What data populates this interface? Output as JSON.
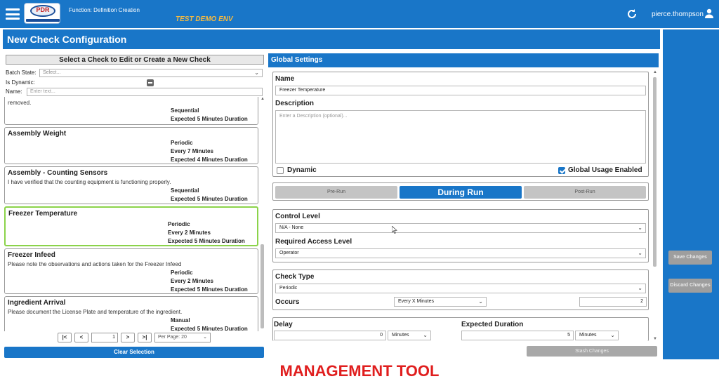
{
  "app": {
    "function_label": "Function: Definition Creation",
    "env_label": "TEST DEMO ENV",
    "logo_text": "PDR",
    "user": "pierce.thompson"
  },
  "page": {
    "title": "New Check Configuration"
  },
  "left": {
    "header": "Select a Check to Edit or Create a New Check",
    "batch_state_label": "Batch State:",
    "batch_state_placeholder": "Select...",
    "is_dynamic_label": "Is Dynamic:",
    "name_label": "Name:",
    "name_placeholder": "Enter text...",
    "cards": [
      {
        "title": "",
        "desc": "removed.",
        "type": "Sequential",
        "frequency": "",
        "duration": "Expected 5 Minutes Duration"
      },
      {
        "title": "Assembly Weight",
        "desc": "",
        "type": "Periodic",
        "frequency": "Every 7 Minutes",
        "duration": "Expected 4 Minutes Duration"
      },
      {
        "title": "Assembly - Counting Sensors",
        "desc": "I have verified that the counting equipment is functioning properly.",
        "type": "Sequential",
        "frequency": "",
        "duration": "Expected 5 Minutes Duration"
      },
      {
        "title": "Freezer Temperature",
        "desc": "",
        "type": "Periodic",
        "frequency": "Every 2 Minutes",
        "duration": "Expected 5 Minutes Duration"
      },
      {
        "title": "Freezer Infeed",
        "desc": "Please note the observations and actions taken for the Freezer Infeed",
        "type": "Periodic",
        "frequency": "Every 2 Minutes",
        "duration": "Expected 5 Minutes Duration"
      },
      {
        "title": "Ingredient Arrival",
        "desc": "Please document the License Plate and temperature of the ingredient.",
        "type": "Manual",
        "frequency": "",
        "duration": "Expected 5 Minutes Duration"
      }
    ],
    "pager": {
      "first": "|<",
      "prev": "<",
      "page": "1",
      "next": ">",
      "last": ">|",
      "per_page": "Per Page: 20"
    },
    "clear_label": "Clear Selection"
  },
  "global_settings": {
    "header": "Global Settings",
    "name_label": "Name",
    "name_value": "Freezer Temperature",
    "description_label": "Description",
    "description_placeholder": "Enter a Description (optional)...",
    "dynamic_label": "Dynamic",
    "dynamic_checked": false,
    "global_usage_label": "Global Usage Enabled",
    "global_usage_checked": true,
    "phases": [
      "Pre-Run",
      "During Run",
      "Post-Run"
    ],
    "active_phase": "During Run",
    "control_level_label": "Control Level",
    "control_level_value": "N/A - None",
    "access_level_label": "Required Access Level",
    "access_level_value": "Operator",
    "check_type_label": "Check Type",
    "check_type_value": "Periodic",
    "occurs_label": "Occurs",
    "occurs_value": "Every X Minutes",
    "occurs_number": "2",
    "delay_label": "Delay",
    "delay_value": "0",
    "delay_unit": "Minutes",
    "expected_duration_label": "Expected Duration",
    "expected_duration_value": "5",
    "expected_duration_unit": "Minutes",
    "stash_label": "Stash Changes"
  },
  "actions": {
    "save_label": "Save Changes",
    "discard_label": "Discard Changes"
  },
  "caption": "MANAGEMENT TOOL",
  "colors": {
    "primary": "#1976c8",
    "selected_border": "#8bd34a",
    "env_label": "#f4b942",
    "caption": "#e01e1e"
  }
}
